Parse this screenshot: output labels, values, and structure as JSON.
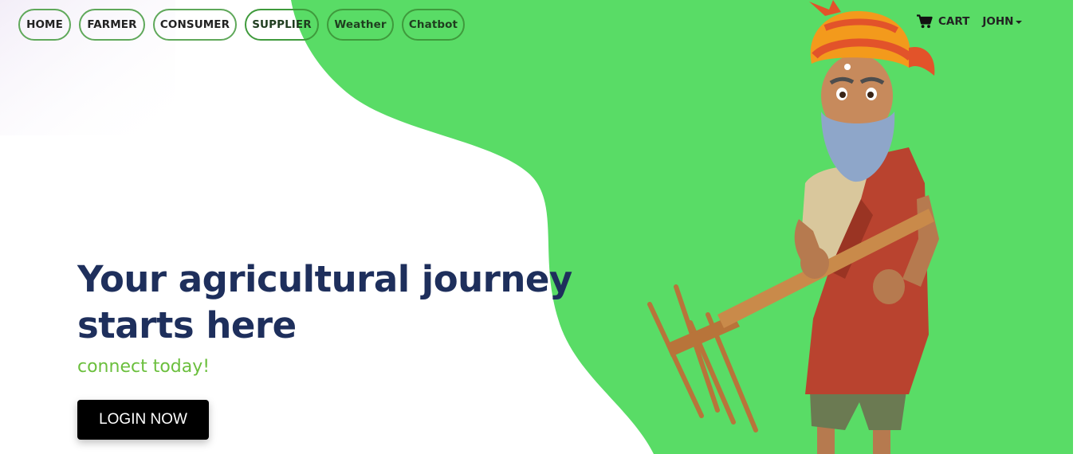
{
  "nav": {
    "items": [
      {
        "label": "HOME"
      },
      {
        "label": "FARMER"
      },
      {
        "label": "CONSUMER"
      },
      {
        "label": "SUPPLIER"
      },
      {
        "label": "Weather"
      },
      {
        "label": "Chatbot"
      }
    ],
    "cart_label": "CART",
    "cart_icon": "shopping-cart-icon",
    "user_label": "JOHN"
  },
  "hero": {
    "title": "Your agricultural journey starts here",
    "subtitle": "connect today!",
    "cta_label": "LOGIN NOW"
  },
  "colors": {
    "green_blob": "#59dc66",
    "title_color": "#1e2f5c",
    "subtitle_color": "#6bbf3d",
    "nav_border": "#5fa85a",
    "button_bg": "#000000"
  },
  "illustration": {
    "name": "farmer-illustration"
  }
}
